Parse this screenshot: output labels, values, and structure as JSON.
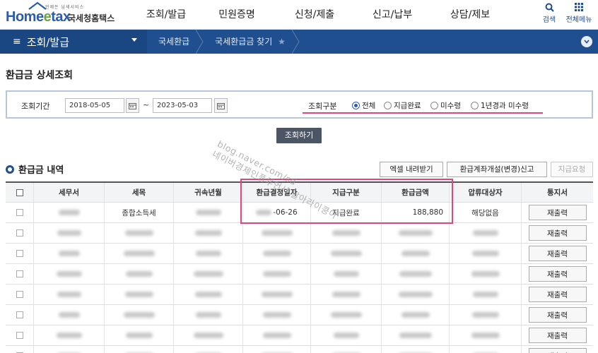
{
  "header": {
    "tagline": "언제든 납세서비스",
    "brand_part1": "Home",
    "brand_part2": "tax",
    "brand_kr": "국세청홈택스",
    "gnb": [
      "조회/발급",
      "민원증명",
      "신청/제출",
      "신고/납부",
      "상담/제보"
    ],
    "search_label": "검색",
    "menu_label": "전체메뉴"
  },
  "navbar": {
    "menu_title": "조회/발급",
    "crumb1": "국세환급",
    "crumb2": "국세환급금 찾기",
    "star": "★"
  },
  "page": {
    "title": "환급금 상세조회"
  },
  "search": {
    "period_label": "조회기간",
    "date_from": "2018-05-05",
    "tilde": "~",
    "date_to": "2023-05-03",
    "type_label": "조회구분",
    "options": [
      "전체",
      "지급완료",
      "미수령",
      "1년경과 미수령"
    ],
    "selected_index": 0,
    "button_label": "조회하기"
  },
  "list": {
    "title": "환급금 내역",
    "btn_excel": "엑셀 내려받기",
    "btn_account": "환급계좌개설(변경)신고",
    "btn_request": "지급요청",
    "columns": [
      "세무서",
      "세목",
      "귀속년월",
      "환급결정일자",
      "지급구분",
      "환급금액",
      "압류대상자",
      "통지서"
    ],
    "first_row": {
      "tax_type": "종합소득세",
      "decision_date_suffix": "-06-26",
      "payment_type": "지급완료",
      "amount": "188,880",
      "seizure": "해당없음",
      "reissue": "재출력"
    },
    "other_reissue": "재출력"
  },
  "watermark": {
    "line1": "blog.naver.com/sd",
    "line2": "네이버경제인플루언서 날아라이쿵아"
  },
  "colors": {
    "brand_blue": "#2a5db0",
    "nav_blue": "#1f4f8e",
    "highlight_pink": "#e0457b"
  }
}
